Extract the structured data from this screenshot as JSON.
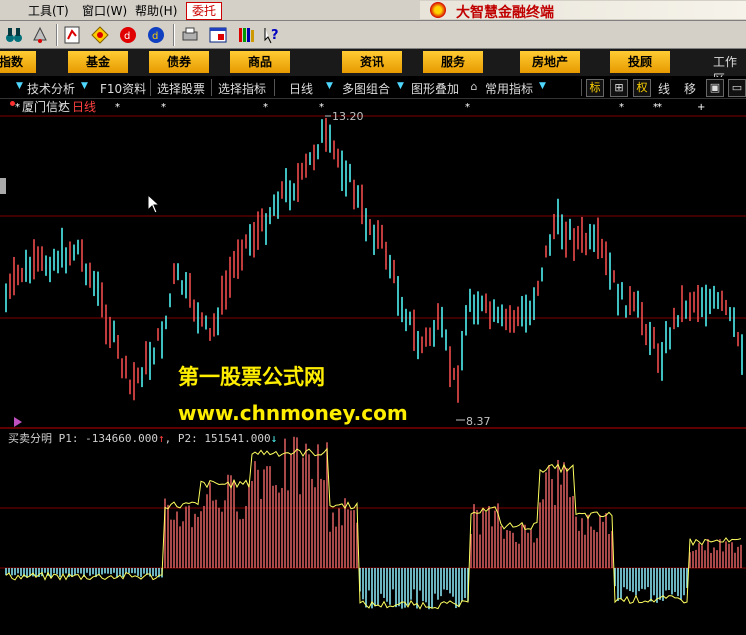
{
  "menubar": {
    "items": [
      "工具(T)",
      "窗口(W)",
      "帮助(H)"
    ],
    "delegate_label": "委托"
  },
  "brand": {
    "title": "大智慧金融终端"
  },
  "toolbar": {
    "icons": [
      "binoculars-icon",
      "alarm-icon",
      "quote-icon",
      "diamond-icon",
      "red-circle-icon",
      "blue-circle-icon",
      "print-icon",
      "layout-icon",
      "books-icon",
      "help-icon"
    ]
  },
  "nav": {
    "items": [
      "指数",
      "基金",
      "债券",
      "商品",
      "资讯",
      "服务",
      "房地产",
      "投顾"
    ],
    "workspace": "工作区"
  },
  "funcbar": {
    "tech": "技术分析",
    "f10": "F10资料",
    "select_stock": "选择股票",
    "select_indicator": "选择指标",
    "period": "日线",
    "multi": "多图组合",
    "overlay": "图形叠加",
    "common": "常用指标",
    "right_buttons": [
      "标",
      "权",
      "线",
      "移"
    ]
  },
  "chart": {
    "stock_name": "厦门信达",
    "period": "日线",
    "high_label": "13.20",
    "low_label": "8.37",
    "indicator_name": "买卖分明",
    "p1_label": "P1:",
    "p1_value": "-134660.000",
    "p2_label": "P2:",
    "p2_value": "151541.000",
    "colors": {
      "up": "#ff5050",
      "down": "#54ffff",
      "line": "#ffff60",
      "grid": "#800000"
    }
  },
  "watermark": {
    "line1": "第一股票公式网",
    "line2": "www.chnmoney.com"
  },
  "chart_data": {
    "type": "candlestick+bar",
    "price_high": 13.2,
    "price_low": 8.37,
    "indicator": "买卖分明",
    "P1": -134660.0,
    "P2": 151541.0
  }
}
